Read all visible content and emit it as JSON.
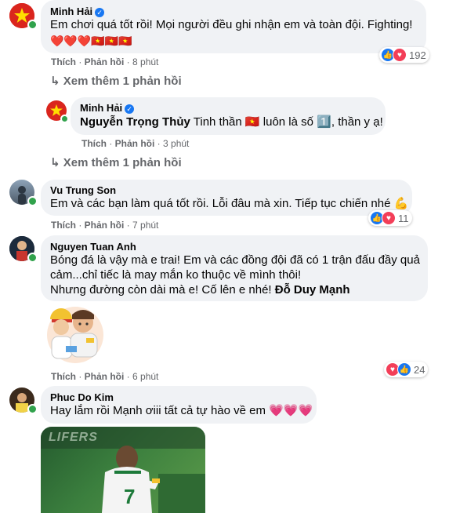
{
  "comments": [
    {
      "author": "Minh Hải",
      "verified": true,
      "text": "Em chơi quá tốt rồi! Mọi người đều ghi nhận em và toàn đội. Fighting!",
      "emojis": "❤️❤️❤️🇻🇳🇻🇳🇻🇳",
      "like_label": "Thích",
      "reply_label": "Phản hồi",
      "time": "8 phút",
      "reaction_count": "192",
      "more_replies": "Xem thêm 1 phản hồi"
    },
    {
      "author": "Minh Hải",
      "verified": true,
      "mention": "Nguyễn Trọng Thủy",
      "text_1": "Tinh thần",
      "text_2": "luôn là số",
      "text_3": ", thần y ạ!",
      "like_label": "Thích",
      "reply_label": "Phản hồi",
      "time": "3 phút",
      "more_replies": "Xem thêm 1 phản hồi"
    },
    {
      "author": "Vu Trung Son",
      "text": "Em và các bạn làm quá tốt rồi. Lỗi đâu mà xin. Tiếp tục chiến nhé 💪",
      "like_label": "Thích",
      "reply_label": "Phản hồi",
      "time": "7 phút",
      "reaction_count": "11"
    },
    {
      "author": "Nguyen Tuan Anh",
      "line_1": "Bóng đá là vậy mà e trai! Em và các đồng đội đã có 1 trận đấu đầy quả",
      "line_2": "cảm...chỉ tiếc là may mắn ko thuộc về mình thôi!",
      "line_3": "Nhưng đường còn dài mà e! Cố lên e nhé!",
      "mention": "Đỗ Duy Mạnh",
      "like_label": "Thích",
      "reply_label": "Phản hồi",
      "time": "6 phút",
      "reaction_count": "24"
    },
    {
      "author": "Phuc Do Kim",
      "text": "Hay lắm rồi Mạnh ơiii tất cả tự hào về em",
      "photo_text": "LIFERS"
    }
  ],
  "colors": {
    "bubble": "#f0f2f5",
    "meta": "#65676b",
    "like_blue": "#1877f2",
    "love_red": "#f33e58",
    "online_green": "#31a24c"
  },
  "icons": [
    "reply-arrow-icon",
    "verified-badge-icon",
    "like-reaction-icon",
    "love-reaction-icon"
  ]
}
